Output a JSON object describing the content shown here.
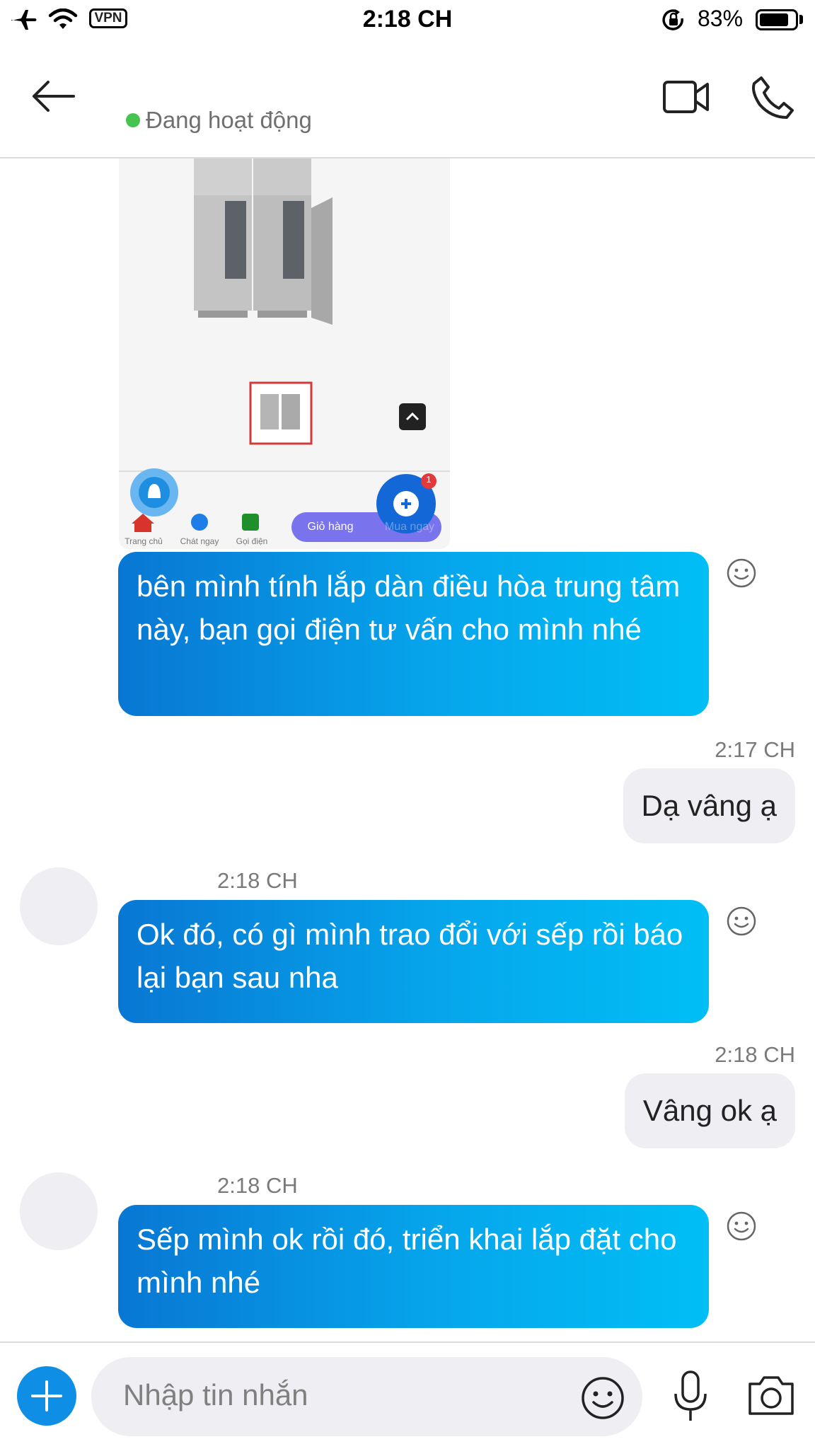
{
  "status_bar": {
    "time": "2:18 CH",
    "vpn": "VPN",
    "battery": "83%",
    "battery_level": 0.83
  },
  "header": {
    "status_text": "Đang hoạt động"
  },
  "shared_image": {
    "nav_items": [
      "Trang chủ",
      "Chát ngay",
      "Gọi điện"
    ],
    "cart_label": "Giỏ hàng",
    "buy_label": "Mua ngay",
    "badge": "1"
  },
  "messages": [
    {
      "dir": "out",
      "text": "bên mình tính lắp dàn điều hòa trung tâm này, bạn gọi điện tư vấn cho mình nhé"
    },
    {
      "dir": "in",
      "time": "2:17 CH",
      "text": "Dạ vâng ạ"
    },
    {
      "dir": "out",
      "time": "2:18 CH",
      "text": "Ok đó, có gì mình trao đổi với sếp rồi báo lại bạn sau nha"
    },
    {
      "dir": "in",
      "time": "2:18 CH",
      "text": "Vâng ok ạ"
    },
    {
      "dir": "out",
      "time": "2:18 CH",
      "text": "Sếp mình ok rồi đó, triển khai lắp đặt cho mình nhé"
    }
  ],
  "input": {
    "placeholder": "Nhập tin nhắn"
  },
  "colors": {
    "accent": "#0e8ee5",
    "bubble_out_start": "#0877d3",
    "bubble_out_end": "#00bff5",
    "bubble_in": "#eeeef3",
    "online": "#46c450"
  }
}
